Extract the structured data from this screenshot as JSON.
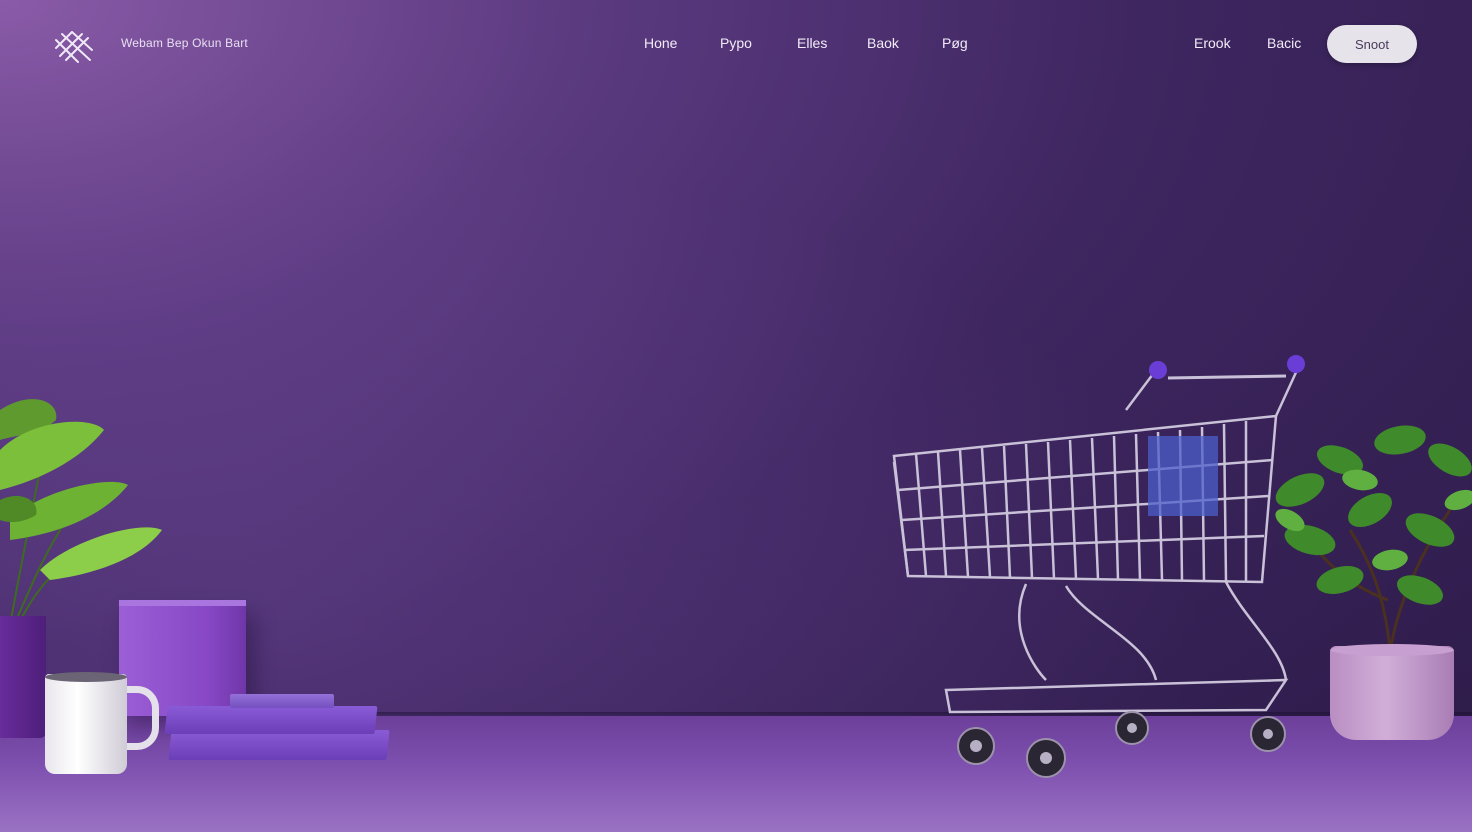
{
  "brand": {
    "name": "Webam Bep Okun Bart",
    "logo_icon": "crosshatch-logo-icon"
  },
  "nav": {
    "links": [
      "Hone",
      "Pypo",
      "Elles",
      "Bаok",
      "Pøg"
    ],
    "right_links": [
      "Erook",
      "Bacic"
    ],
    "cta_label": "Snoot"
  },
  "colors": {
    "background_dark": "#2c1b48",
    "background_light": "#8a5ba8",
    "floor": "#7d4fae",
    "accent": "#8848c6",
    "cta_bg": "#e6e3ea"
  },
  "scene": {
    "objects": [
      "shopping-cart",
      "potted-plant-left",
      "purple-cube",
      "mug",
      "book-stack",
      "potted-plant-right"
    ]
  }
}
